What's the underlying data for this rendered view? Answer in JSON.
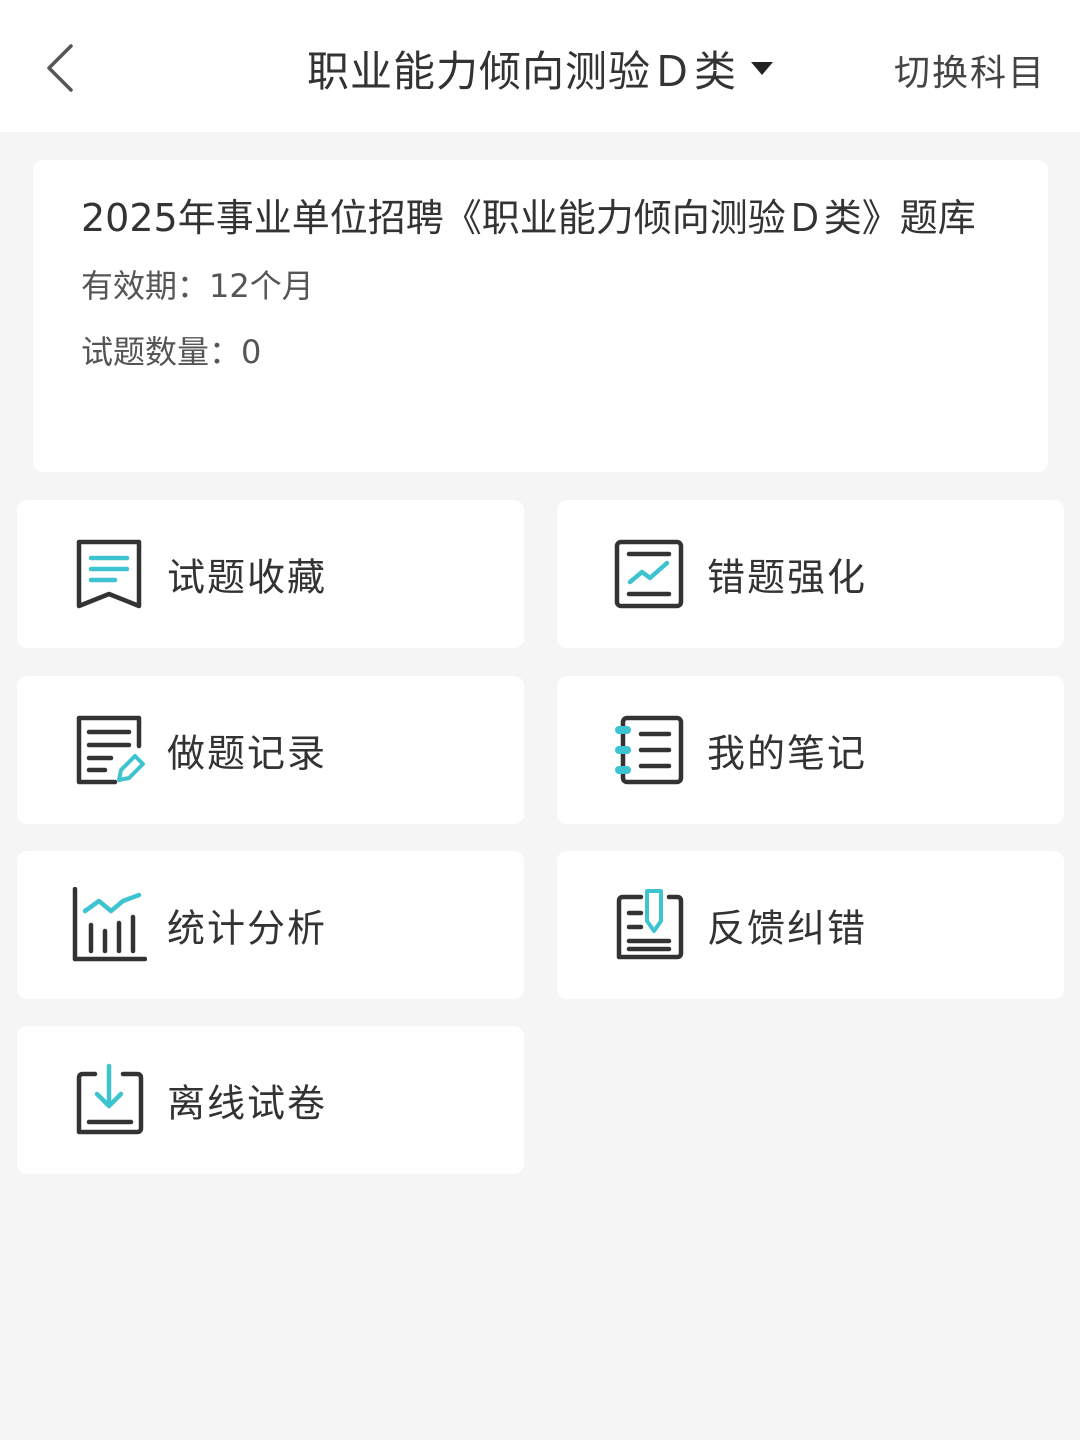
{
  "header": {
    "title": "职业能力倾向测验Ｄ类",
    "switch_label": "切换科目"
  },
  "bank": {
    "title": "2025年事业单位招聘《职业能力倾向测验Ｄ类》题库",
    "validity": "有效期：12个月",
    "question_count": "试题数量：0"
  },
  "menu": [
    {
      "label": "试题收藏",
      "icon": "bookmark-icon"
    },
    {
      "label": "错题强化",
      "icon": "trend-chart-icon"
    },
    {
      "label": "做题记录",
      "icon": "record-edit-icon"
    },
    {
      "label": "我的笔记",
      "icon": "notebook-icon"
    },
    {
      "label": "统计分析",
      "icon": "bar-chart-icon"
    },
    {
      "label": "反馈纠错",
      "icon": "feedback-pen-icon"
    },
    {
      "label": "离线试卷",
      "icon": "download-icon"
    }
  ],
  "colors": {
    "accent": "#3ec3d0",
    "icon_stroke": "#333333",
    "background": "#f5f5f5"
  }
}
